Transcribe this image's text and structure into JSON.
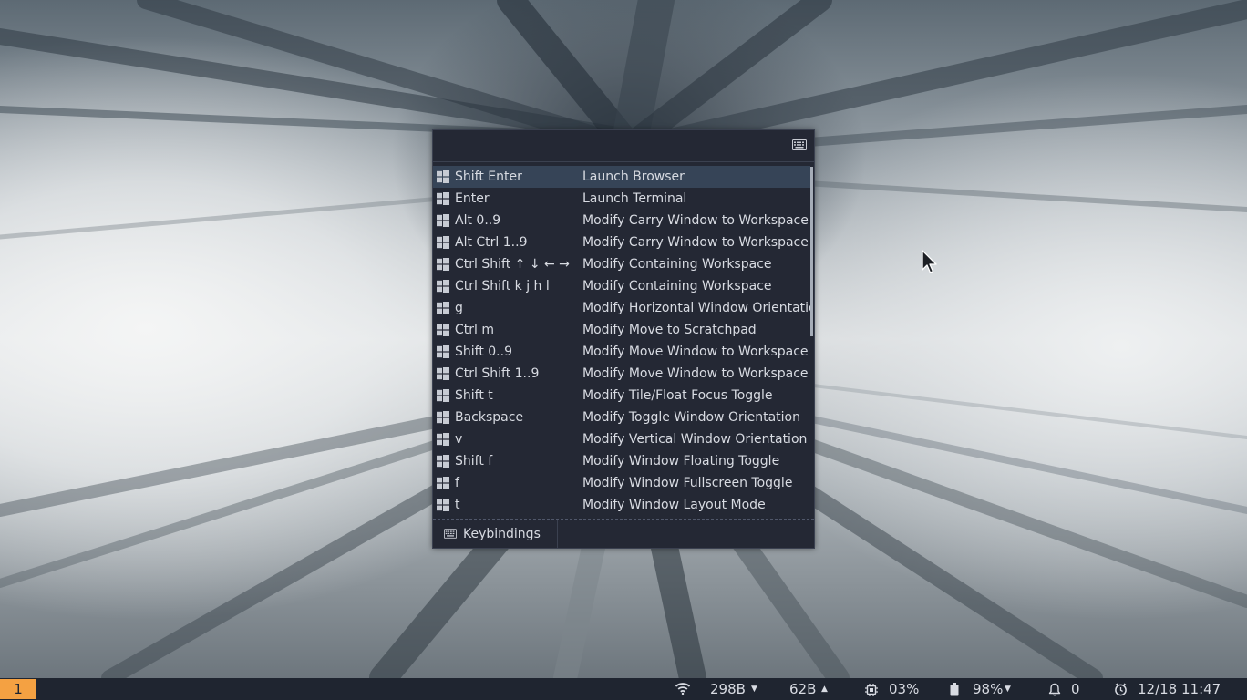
{
  "launcher": {
    "prompt_value": "",
    "prompt_icon": "keyboard-icon",
    "mode_label": "Keybindings",
    "mode_icon": "keyboard-icon",
    "modifier_icon": "windows-key-icon",
    "rows": [
      {
        "keys": "Shift Enter",
        "action": "Launch Browser",
        "selected": true
      },
      {
        "keys": "Enter",
        "action": "Launch Terminal"
      },
      {
        "keys": "Alt 0..9",
        "action": "Modify Carry Window to Workspace"
      },
      {
        "keys": "Alt Ctrl 1..9",
        "action": "Modify Carry Window to Workspace"
      },
      {
        "keys": "Ctrl Shift ↑ ↓ ← →",
        "action": "Modify Containing Workspace"
      },
      {
        "keys": "Ctrl Shift k j h l",
        "action": "Modify Containing Workspace"
      },
      {
        "keys": "g",
        "action": "Modify Horizontal Window Orientation"
      },
      {
        "keys": "Ctrl m",
        "action": "Modify Move to Scratchpad"
      },
      {
        "keys": "Shift 0..9",
        "action": "Modify Move Window to Workspace"
      },
      {
        "keys": "Ctrl Shift 1..9",
        "action": "Modify Move Window to Workspace"
      },
      {
        "keys": "Shift t",
        "action": "Modify Tile/Float Focus Toggle"
      },
      {
        "keys": "Backspace",
        "action": "Modify Toggle Window Orientation"
      },
      {
        "keys": "v",
        "action": "Modify Vertical Window Orientation"
      },
      {
        "keys": "Shift f",
        "action": "Modify Window Floating Toggle"
      },
      {
        "keys": "f",
        "action": "Modify Window Fullscreen Toggle"
      },
      {
        "keys": "t",
        "action": "Modify Window Layout Mode"
      }
    ]
  },
  "statusbar": {
    "workspace": "1",
    "workspace_color": "#f4a142",
    "net_down": "298B",
    "net_up": "62B",
    "cpu": "03%",
    "battery": "98%",
    "notifications": "0",
    "datetime": "12/18 11:47",
    "icons": [
      "wifi-icon",
      "cpu-icon",
      "battery-icon",
      "bell-icon",
      "clock-icon"
    ]
  }
}
